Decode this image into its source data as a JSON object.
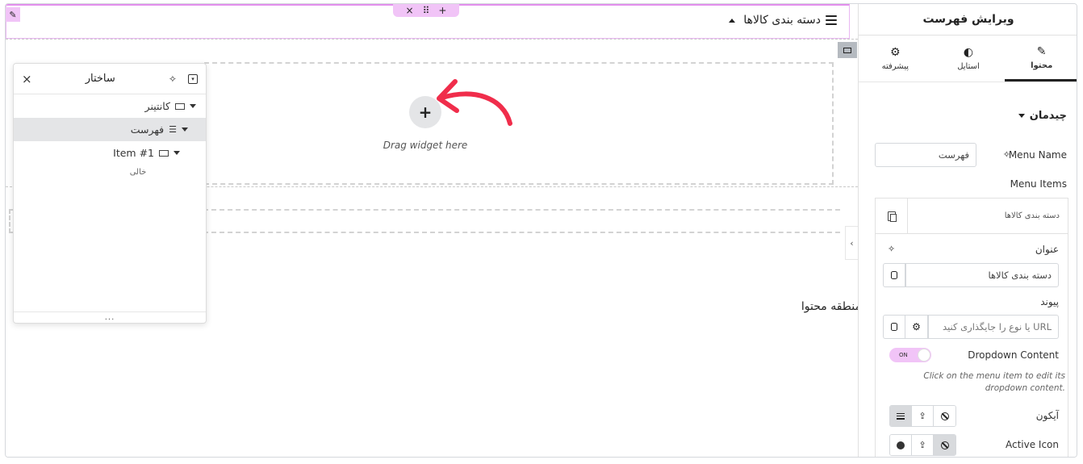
{
  "canvas": {
    "toolbar": {
      "add": "+",
      "drag": "⠿",
      "close": "×"
    },
    "nav_title": "دسته بندی کالاها",
    "dropzone_text": "Drag widget here",
    "add_symbol": "+",
    "content_area_label": "منطقه محتوا",
    "collapse_glyph": "‹"
  },
  "structure_panel": {
    "title": "ساختار",
    "close_glyph": "×",
    "items": [
      {
        "label": "کانتینر"
      },
      {
        "label": "فهرست"
      },
      {
        "label": "Item #1"
      }
    ],
    "empty_label": "خالی",
    "footer": "..."
  },
  "editor": {
    "title": "ویرایش فهرست",
    "tabs": [
      {
        "label": "محتوا",
        "icon": "pencil-icon",
        "glyph": "✎",
        "active": true
      },
      {
        "label": "استایل",
        "icon": "half-circle-icon",
        "glyph": "◐",
        "active": false
      },
      {
        "label": "پیشرفته",
        "icon": "gear-icon",
        "glyph": "⚙",
        "active": false
      }
    ],
    "section_title": "چیدمان",
    "menu_name_label": "Menu Name",
    "menu_name_value": "فهرست",
    "menu_items_label": "Menu Items",
    "repeater_item_label": "دسته بندی کالاها",
    "title_label": "عنوان",
    "title_value": "دسته بندی کالاها",
    "link_label": "پیوند",
    "link_placeholder": "URL یا نوع را جایگذاری کنید",
    "dropdown_label": "Dropdown Content",
    "toggle_text": "ON",
    "help_text": "Click on the menu item to edit its dropdown content.",
    "icon_label": "آیکون",
    "active_icon_label": "Active Icon",
    "accent_color": "#f1c4f7",
    "arrow_color": "#f02d4b"
  }
}
